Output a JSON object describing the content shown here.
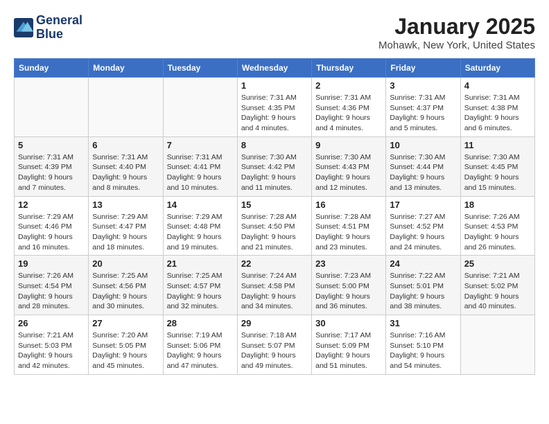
{
  "header": {
    "logo_line1": "General",
    "logo_line2": "Blue",
    "month_year": "January 2025",
    "location": "Mohawk, New York, United States"
  },
  "weekdays": [
    "Sunday",
    "Monday",
    "Tuesday",
    "Wednesday",
    "Thursday",
    "Friday",
    "Saturday"
  ],
  "weeks": [
    [
      {
        "day": "",
        "info": ""
      },
      {
        "day": "",
        "info": ""
      },
      {
        "day": "",
        "info": ""
      },
      {
        "day": "1",
        "info": "Sunrise: 7:31 AM\nSunset: 4:35 PM\nDaylight: 9 hours\nand 4 minutes."
      },
      {
        "day": "2",
        "info": "Sunrise: 7:31 AM\nSunset: 4:36 PM\nDaylight: 9 hours\nand 4 minutes."
      },
      {
        "day": "3",
        "info": "Sunrise: 7:31 AM\nSunset: 4:37 PM\nDaylight: 9 hours\nand 5 minutes."
      },
      {
        "day": "4",
        "info": "Sunrise: 7:31 AM\nSunset: 4:38 PM\nDaylight: 9 hours\nand 6 minutes."
      }
    ],
    [
      {
        "day": "5",
        "info": "Sunrise: 7:31 AM\nSunset: 4:39 PM\nDaylight: 9 hours\nand 7 minutes."
      },
      {
        "day": "6",
        "info": "Sunrise: 7:31 AM\nSunset: 4:40 PM\nDaylight: 9 hours\nand 8 minutes."
      },
      {
        "day": "7",
        "info": "Sunrise: 7:31 AM\nSunset: 4:41 PM\nDaylight: 9 hours\nand 10 minutes."
      },
      {
        "day": "8",
        "info": "Sunrise: 7:30 AM\nSunset: 4:42 PM\nDaylight: 9 hours\nand 11 minutes."
      },
      {
        "day": "9",
        "info": "Sunrise: 7:30 AM\nSunset: 4:43 PM\nDaylight: 9 hours\nand 12 minutes."
      },
      {
        "day": "10",
        "info": "Sunrise: 7:30 AM\nSunset: 4:44 PM\nDaylight: 9 hours\nand 13 minutes."
      },
      {
        "day": "11",
        "info": "Sunrise: 7:30 AM\nSunset: 4:45 PM\nDaylight: 9 hours\nand 15 minutes."
      }
    ],
    [
      {
        "day": "12",
        "info": "Sunrise: 7:29 AM\nSunset: 4:46 PM\nDaylight: 9 hours\nand 16 minutes."
      },
      {
        "day": "13",
        "info": "Sunrise: 7:29 AM\nSunset: 4:47 PM\nDaylight: 9 hours\nand 18 minutes."
      },
      {
        "day": "14",
        "info": "Sunrise: 7:29 AM\nSunset: 4:48 PM\nDaylight: 9 hours\nand 19 minutes."
      },
      {
        "day": "15",
        "info": "Sunrise: 7:28 AM\nSunset: 4:50 PM\nDaylight: 9 hours\nand 21 minutes."
      },
      {
        "day": "16",
        "info": "Sunrise: 7:28 AM\nSunset: 4:51 PM\nDaylight: 9 hours\nand 23 minutes."
      },
      {
        "day": "17",
        "info": "Sunrise: 7:27 AM\nSunset: 4:52 PM\nDaylight: 9 hours\nand 24 minutes."
      },
      {
        "day": "18",
        "info": "Sunrise: 7:26 AM\nSunset: 4:53 PM\nDaylight: 9 hours\nand 26 minutes."
      }
    ],
    [
      {
        "day": "19",
        "info": "Sunrise: 7:26 AM\nSunset: 4:54 PM\nDaylight: 9 hours\nand 28 minutes."
      },
      {
        "day": "20",
        "info": "Sunrise: 7:25 AM\nSunset: 4:56 PM\nDaylight: 9 hours\nand 30 minutes."
      },
      {
        "day": "21",
        "info": "Sunrise: 7:25 AM\nSunset: 4:57 PM\nDaylight: 9 hours\nand 32 minutes."
      },
      {
        "day": "22",
        "info": "Sunrise: 7:24 AM\nSunset: 4:58 PM\nDaylight: 9 hours\nand 34 minutes."
      },
      {
        "day": "23",
        "info": "Sunrise: 7:23 AM\nSunset: 5:00 PM\nDaylight: 9 hours\nand 36 minutes."
      },
      {
        "day": "24",
        "info": "Sunrise: 7:22 AM\nSunset: 5:01 PM\nDaylight: 9 hours\nand 38 minutes."
      },
      {
        "day": "25",
        "info": "Sunrise: 7:21 AM\nSunset: 5:02 PM\nDaylight: 9 hours\nand 40 minutes."
      }
    ],
    [
      {
        "day": "26",
        "info": "Sunrise: 7:21 AM\nSunset: 5:03 PM\nDaylight: 9 hours\nand 42 minutes."
      },
      {
        "day": "27",
        "info": "Sunrise: 7:20 AM\nSunset: 5:05 PM\nDaylight: 9 hours\nand 45 minutes."
      },
      {
        "day": "28",
        "info": "Sunrise: 7:19 AM\nSunset: 5:06 PM\nDaylight: 9 hours\nand 47 minutes."
      },
      {
        "day": "29",
        "info": "Sunrise: 7:18 AM\nSunset: 5:07 PM\nDaylight: 9 hours\nand 49 minutes."
      },
      {
        "day": "30",
        "info": "Sunrise: 7:17 AM\nSunset: 5:09 PM\nDaylight: 9 hours\nand 51 minutes."
      },
      {
        "day": "31",
        "info": "Sunrise: 7:16 AM\nSunset: 5:10 PM\nDaylight: 9 hours\nand 54 minutes."
      },
      {
        "day": "",
        "info": ""
      }
    ]
  ]
}
